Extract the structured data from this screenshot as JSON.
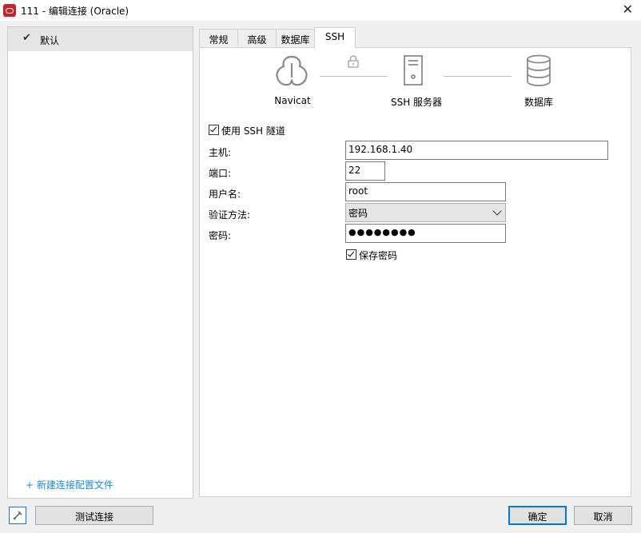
{
  "window": {
    "title": "111 - 编辑连接 (Oracle)",
    "close_glyph": "✕"
  },
  "profiles": {
    "items": [
      {
        "label": "默认",
        "selected": true
      }
    ],
    "new_link": "+ 新建连接配置文件"
  },
  "tabs": [
    {
      "label": "常规"
    },
    {
      "label": "高级"
    },
    {
      "label": "数据库"
    },
    {
      "label": "SSH",
      "active": true
    }
  ],
  "diagram": {
    "navicat": "Navicat",
    "server": "SSH 服务器",
    "database": "数据库"
  },
  "ssh": {
    "use_tunnel_label": "使用 SSH 隧道",
    "host_label": "主机:",
    "host_value": "192.168.1.40",
    "port_label": "端口:",
    "port_value": "22",
    "user_label": "用户名:",
    "user_value": "root",
    "auth_label": "验证方法:",
    "auth_value": "密码",
    "password_label": "密码:",
    "password_mask": "●●●●●●●●",
    "save_password_label": "保存密码"
  },
  "buttons": {
    "test": "测试连接",
    "ok": "确定",
    "cancel": "取消"
  },
  "colors": {
    "accent": "#0078d7",
    "link": "#1e8bd8",
    "oracle_red": "#c8222c"
  }
}
